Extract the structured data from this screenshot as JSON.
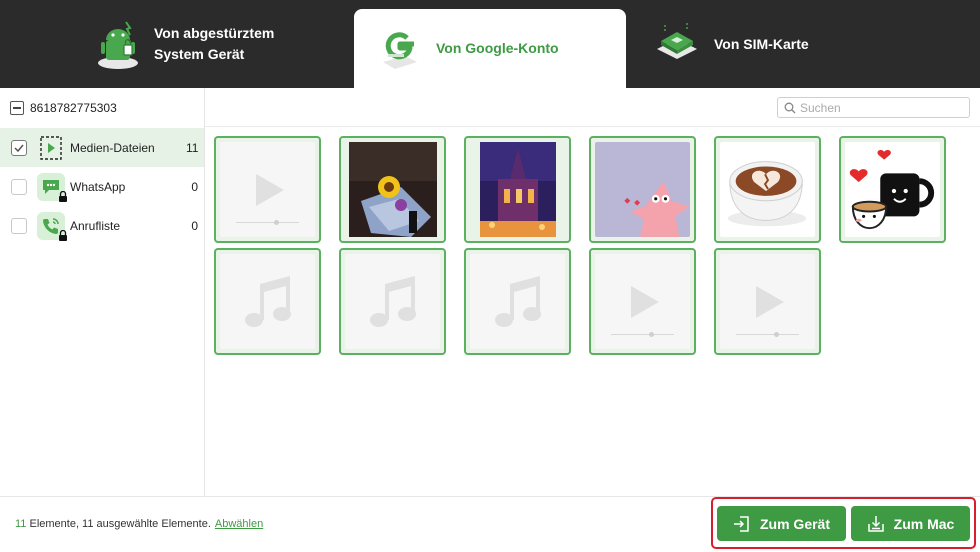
{
  "tabs": [
    {
      "label_line1": "Von abgestürztem",
      "label_line2": "System Gerät",
      "icon": "android-robot-icon",
      "active": false
    },
    {
      "label": "Von Google-Konto",
      "icon": "google-g-icon",
      "active": true
    },
    {
      "label": "Von SIM-Karte",
      "icon": "sim-card-icon",
      "active": false
    }
  ],
  "sidebar": {
    "device_id": "8618782775303",
    "categories": [
      {
        "label": "Medien-Dateien",
        "count": "11",
        "checked": true,
        "icon": "media-file-icon",
        "locked": false
      },
      {
        "label": "WhatsApp",
        "count": "0",
        "checked": false,
        "icon": "whatsapp-chat-icon",
        "locked": true
      },
      {
        "label": "Anrufliste",
        "count": "0",
        "checked": false,
        "icon": "phone-call-icon",
        "locked": true
      }
    ]
  },
  "search": {
    "placeholder": "Suchen"
  },
  "items": [
    {
      "kind": "video",
      "icon": "video-play-icon"
    },
    {
      "kind": "photo",
      "subject": "sunflower-bouquet"
    },
    {
      "kind": "photo",
      "subject": "night-building"
    },
    {
      "kind": "photo",
      "subject": "patrick-star-sticker"
    },
    {
      "kind": "photo",
      "subject": "latte-art-heart"
    },
    {
      "kind": "photo",
      "subject": "coffee-mugs-hearts"
    },
    {
      "kind": "audio",
      "icon": "music-note-icon"
    },
    {
      "kind": "audio",
      "icon": "music-note-icon"
    },
    {
      "kind": "audio",
      "icon": "music-note-icon"
    },
    {
      "kind": "video",
      "icon": "video-play-icon"
    },
    {
      "kind": "video",
      "icon": "video-play-icon"
    }
  ],
  "footer": {
    "count": "11",
    "status_text": " Elemente, 11 ausgewählte Elemente.",
    "select_link": "Abwählen"
  },
  "buttons": {
    "to_device": "Zum Gerät",
    "to_mac": "Zum Mac"
  },
  "colors": {
    "accent": "#3f9a44",
    "topbar": "#2b2b2b",
    "highlight": "#d81e2c",
    "thumb_border": "#5bb160"
  }
}
